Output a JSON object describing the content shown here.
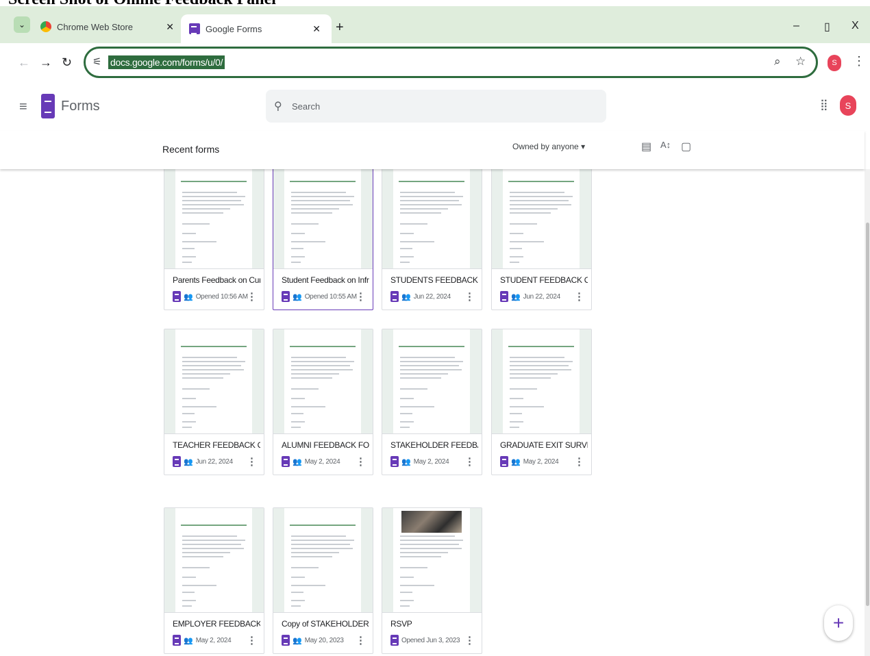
{
  "doc_heading": "Screen Shot of Online Feedback Panel",
  "browser": {
    "tabs": [
      {
        "label": "Chrome Web Store",
        "icon": "chrome-web-store-icon"
      },
      {
        "label": "Google Forms",
        "icon": "google-forms-icon",
        "active": true
      }
    ],
    "new_tab": "+",
    "url": "docs.google.com/forms/u/0/",
    "profile_initial": "S",
    "window_controls": {
      "minimize": "–",
      "restore": "▯",
      "close": "X"
    }
  },
  "app": {
    "name": "Forms",
    "search_placeholder": "Search",
    "avatar_initial": "S"
  },
  "list": {
    "section_label": "Recent forms",
    "owner_filter": "Owned by anyone ▾",
    "cards": [
      {
        "title": "Parents Feedback on Cur...",
        "meta": "Opened 10:56 AM",
        "shared": true,
        "thumb": "form"
      },
      {
        "title": "Student Feedback on Infr...",
        "meta": "Opened 10:55 AM",
        "shared": true,
        "thumb": "form",
        "selected": true
      },
      {
        "title": "STUDENTS FEEDBACK FO...",
        "meta": "Jun 22, 2024",
        "shared": true,
        "thumb": "form"
      },
      {
        "title": "STUDENT FEEDBACK ON ...",
        "meta": "Jun 22, 2024",
        "shared": true,
        "thumb": "form"
      },
      {
        "title": "TEACHER FEEDBACK ON ...",
        "meta": "Jun 22, 2024",
        "shared": true,
        "thumb": "form"
      },
      {
        "title": "ALUMNI FEEDBACK FORM",
        "meta": "May 2, 2024",
        "shared": true,
        "thumb": "form"
      },
      {
        "title": "STAKEHOLDER FEEDBAC...",
        "meta": "May 2, 2024",
        "shared": true,
        "thumb": "form"
      },
      {
        "title": "GRADUATE EXIT SURVEY",
        "meta": "May 2, 2024",
        "shared": true,
        "thumb": "form"
      },
      {
        "title": "EMPLOYER FEEDBACK F...",
        "meta": "May 2, 2024",
        "shared": true,
        "thumb": "form"
      },
      {
        "title": "Copy of STAKEHOLDER F...",
        "meta": "May 20, 2023",
        "shared": true,
        "thumb": "form"
      },
      {
        "title": "RSVP",
        "meta": "Opened Jun 3, 2023",
        "shared": false,
        "thumb": "photo"
      }
    ]
  },
  "colors": {
    "brand": "#673ab7",
    "tabbar": "#dfeddc",
    "omnibox_border": "#2e6c3e",
    "avatar": "#e8445a"
  }
}
